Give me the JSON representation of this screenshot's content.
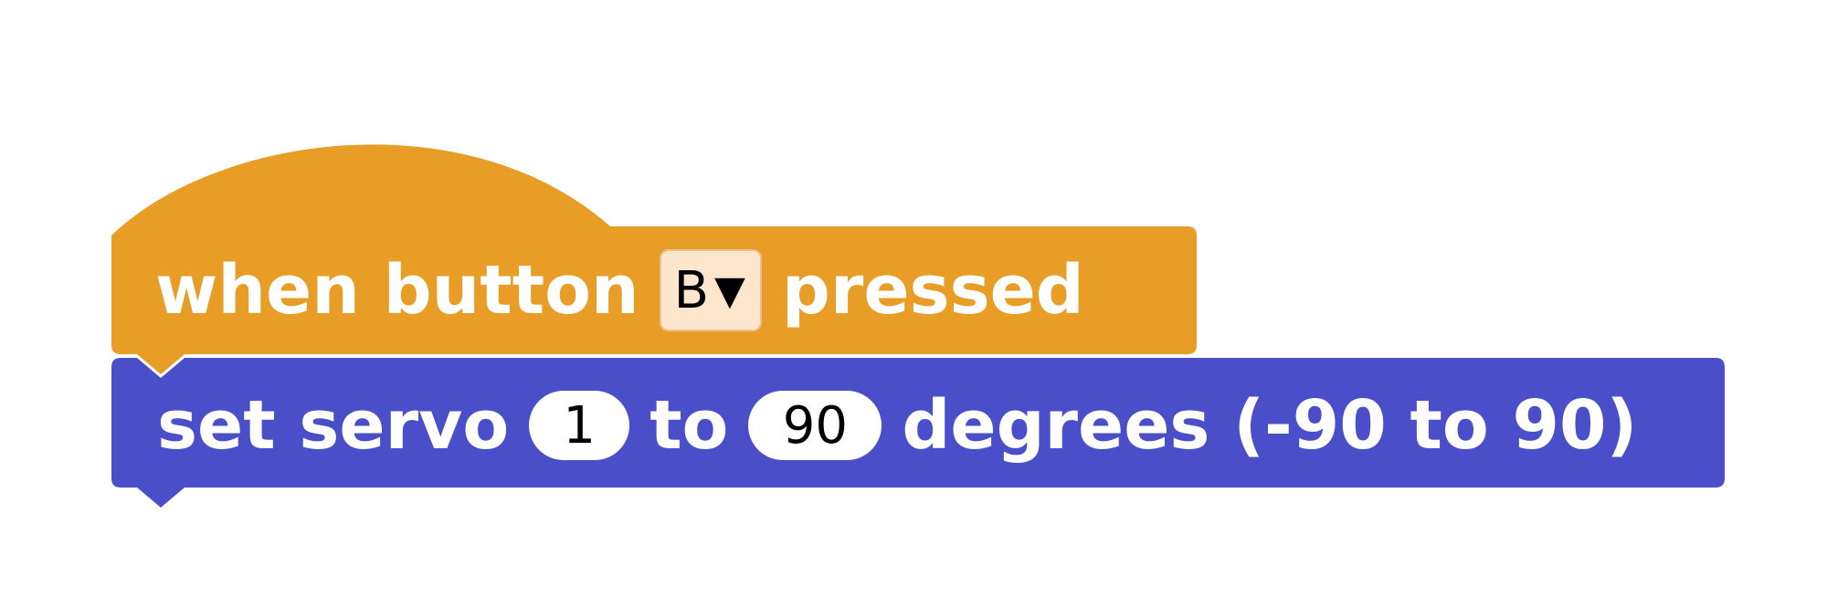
{
  "event_block": {
    "prefix": "when button",
    "button_dropdown": {
      "selected": "B",
      "arrow": "▼"
    },
    "suffix": "pressed",
    "color": "#e79d26"
  },
  "action_block": {
    "prefix": "set servo",
    "servo_value": "1",
    "to_label": "to",
    "degrees_value": "90",
    "suffix": "degrees (-90 to 90)",
    "color": "#4a4fc9"
  }
}
